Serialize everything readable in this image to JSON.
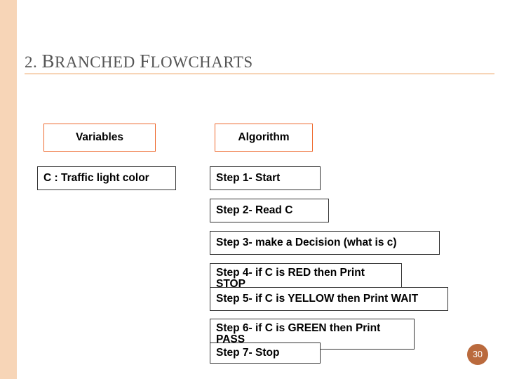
{
  "title_parts": {
    "num": "2. ",
    "c1": "B",
    "w1": "RANCHED ",
    "c2": "F",
    "w2": "LOWCHARTS"
  },
  "variables_header": "Variables",
  "algorithm_header": "Algorithm",
  "var1": "C : Traffic light color",
  "steps": {
    "s1": "Step 1- Start",
    "s2": "Step 2- Read C",
    "s3": "Step 3- make a Decision (what is c)",
    "s4": "Step 4- if C is RED then Print STOP",
    "s5": "Step 5- if C is YELLOW then Print WAIT",
    "s6": "Step 6- if C is GREEN then Print PASS",
    "s7": "Step 7- Stop"
  },
  "page_number": "30"
}
